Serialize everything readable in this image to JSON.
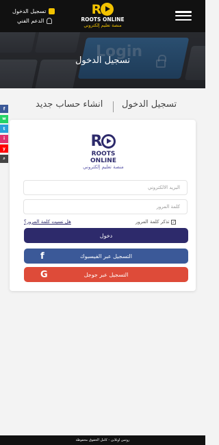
{
  "header": {
    "logo_title": "ROOTS ONLINE",
    "logo_subtitle": "منصة تعليم إلكتروني",
    "login_link": "تسجيل الدخول",
    "support_link": "الدعم الفني",
    "menu_icon": "hamburger-icon"
  },
  "banner": {
    "key_text": "Login",
    "title": "تسجيل الدخول"
  },
  "tabs": {
    "login": "تسجيل الدخول",
    "register": "انشاء حساب جديد"
  },
  "social": [
    {
      "icon": "facebook-icon",
      "glyph": "f",
      "color": "#3b5998"
    },
    {
      "icon": "whatsapp-icon",
      "glyph": "w",
      "color": "#25d366"
    },
    {
      "icon": "telegram-icon",
      "glyph": "t",
      "color": "#2aa1da"
    },
    {
      "icon": "instagram-icon",
      "glyph": "i",
      "color": "#e1306c"
    },
    {
      "icon": "youtube-icon",
      "glyph": "y",
      "color": "#ff0000"
    },
    {
      "icon": "search-icon",
      "glyph": "⌕",
      "color": "#444444"
    }
  ],
  "card": {
    "logo_title": "ROOTS ONLINE",
    "logo_subtitle": "منصة تعليم إلكتروني",
    "email_placeholder": "البريد الالكتروني",
    "password_placeholder": "كلمة المرور",
    "remember_label": "تذكر كلمة المرور",
    "remember_checked": "✓",
    "forgot_link": "هل نسيت كلمة المرور؟",
    "login_button": "دخول",
    "facebook_button": "التسجيل عبر الفيسبوك",
    "facebook_glyph": "f",
    "google_button": "التسجيل عبر جوجل",
    "google_glyph": "G"
  },
  "footer": {
    "text": "روتس اونلاين - كامل الحقوق محفوظة"
  },
  "colors": {
    "accent_yellow": "#f2c200",
    "brand_purple": "#2d2a6b",
    "facebook_blue": "#3b5998",
    "google_red": "#de4b39"
  }
}
